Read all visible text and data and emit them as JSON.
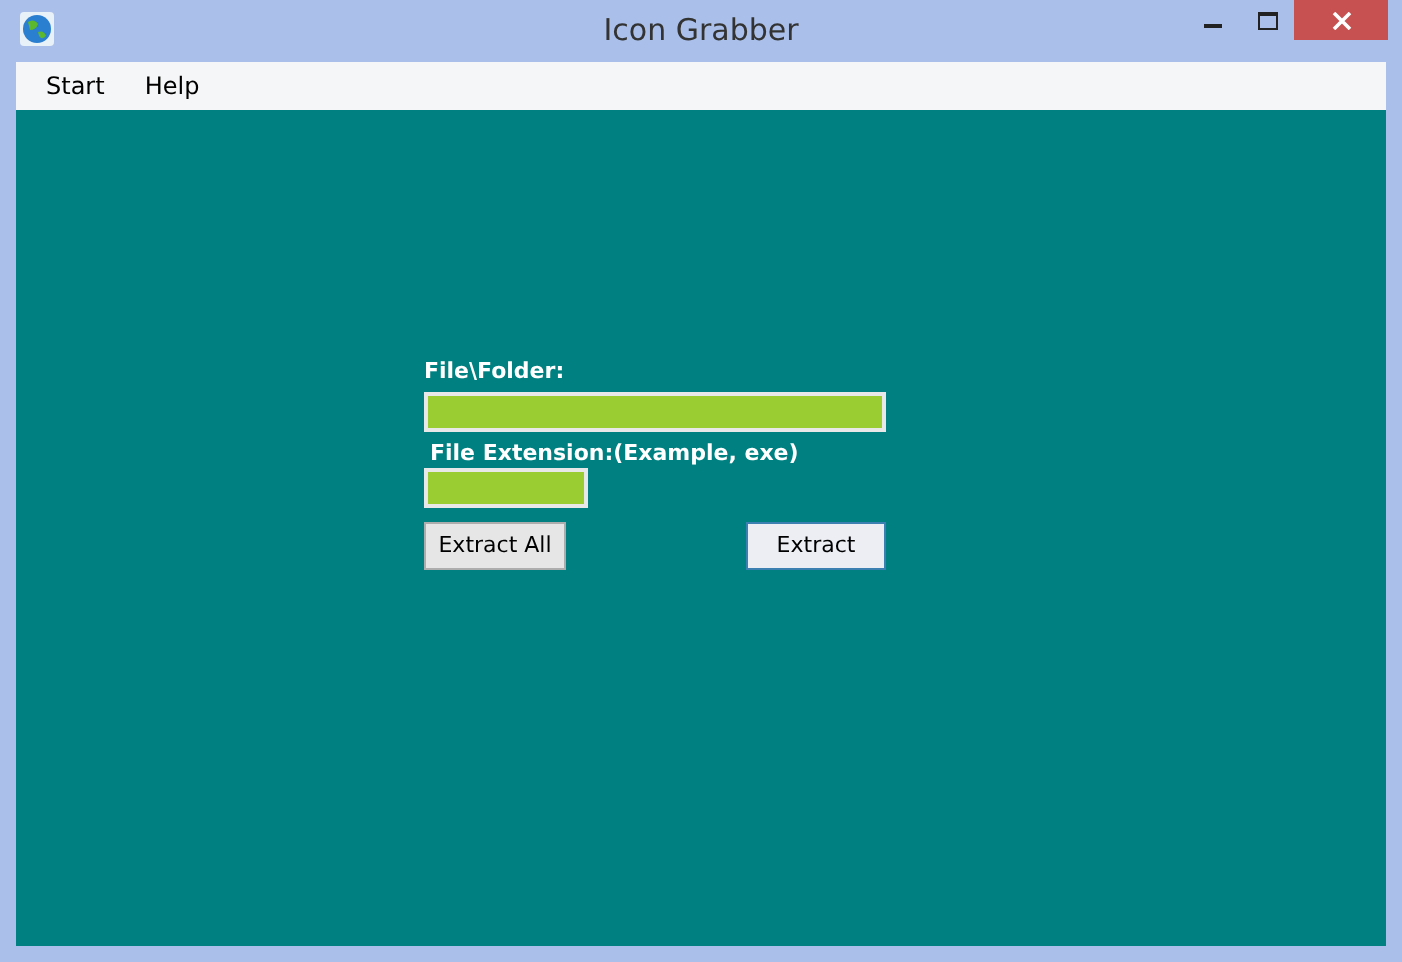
{
  "window": {
    "title": "Icon Grabber"
  },
  "menu": [
    {
      "label": "Start"
    },
    {
      "label": "Help"
    }
  ],
  "fields": [
    {
      "label": "File\\Folder:",
      "kind": "wide"
    },
    {
      "label": "File Extension:(Example, exe)",
      "kind": "narrow"
    }
  ],
  "buttons": [
    {
      "label": "Extract All",
      "focused": false
    },
    {
      "label": "Extract",
      "focused": true
    }
  ]
}
